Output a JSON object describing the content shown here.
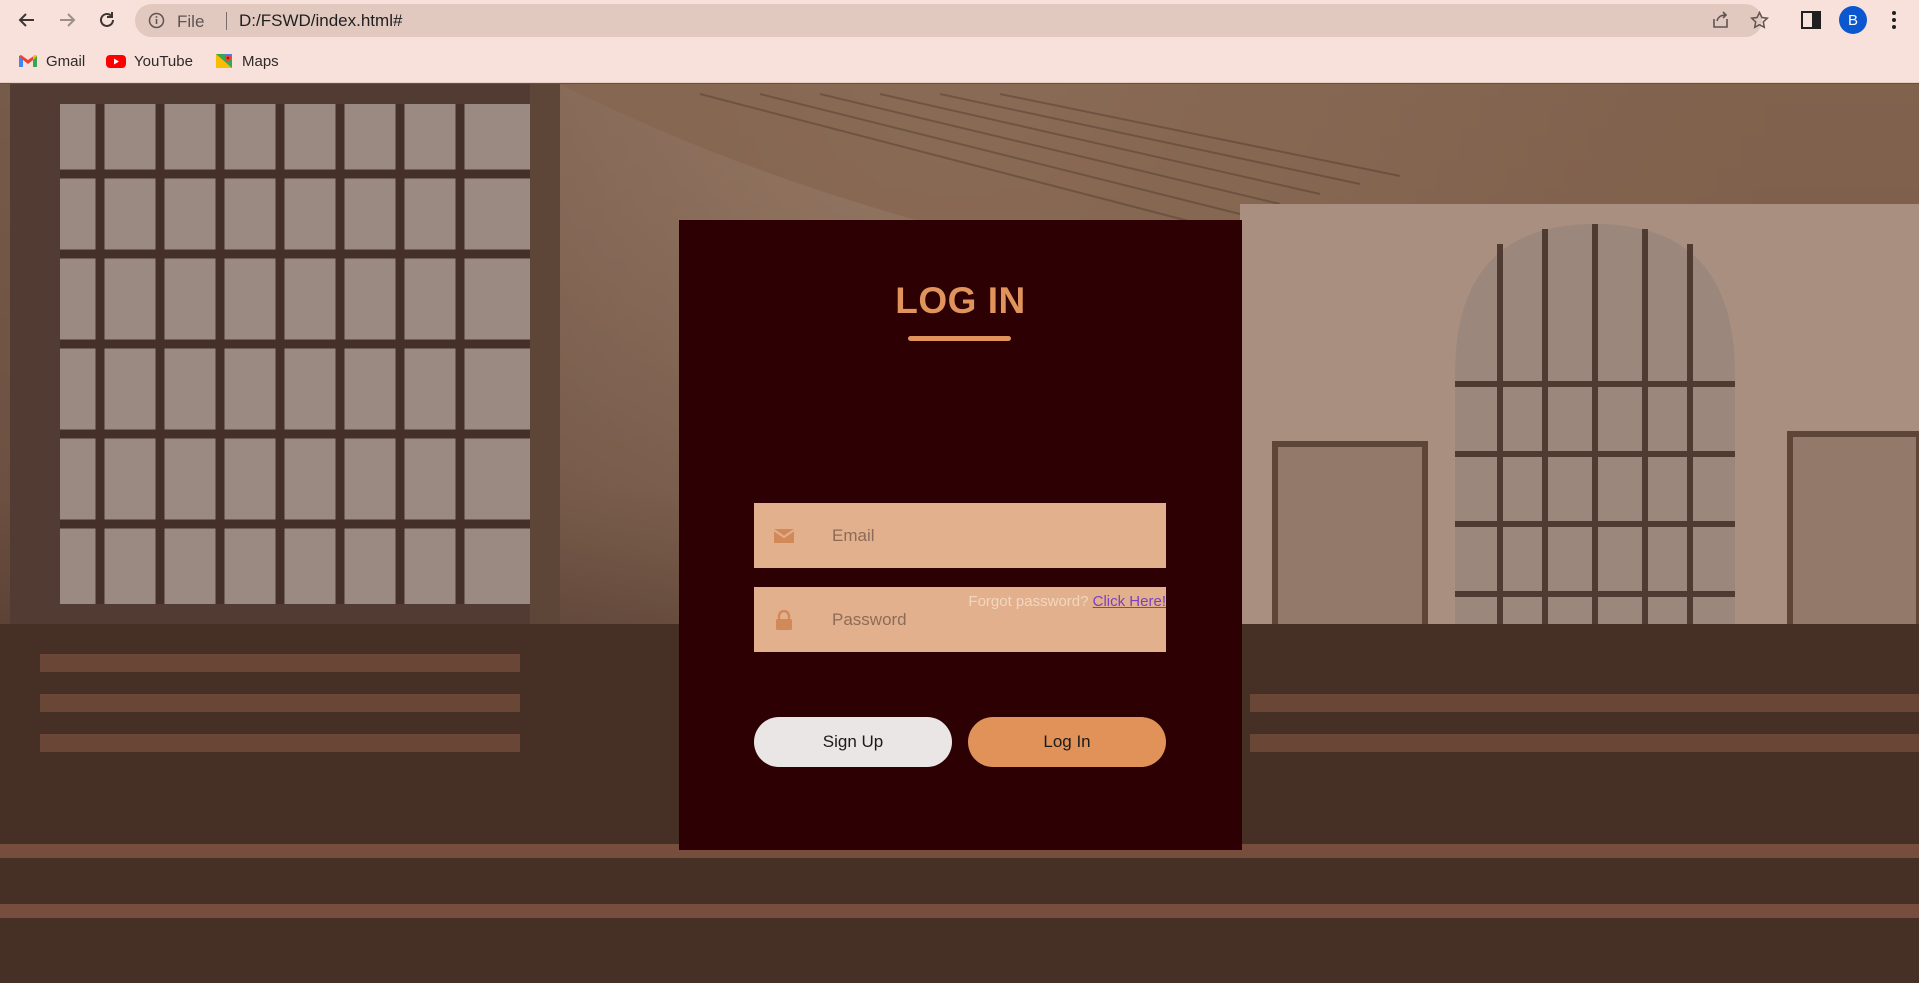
{
  "browser": {
    "url_scheme": "File",
    "url": "D:/FSWD/index.html#",
    "profile_initial": "B",
    "bookmarks": [
      {
        "label": "Gmail",
        "icon": "gmail-icon"
      },
      {
        "label": "YouTube",
        "icon": "youtube-icon"
      },
      {
        "label": "Maps",
        "icon": "maps-icon"
      }
    ]
  },
  "login": {
    "title": "LOG IN",
    "email_placeholder": "Email",
    "password_placeholder": "Password",
    "forgot_text": "Forgot password?",
    "forgot_link": "Click Here!",
    "signup_label": "Sign Up",
    "login_label": "Log In"
  },
  "colors": {
    "card": "#2d0103",
    "accent": "#e1935c",
    "field": "#e3b08d",
    "link": "#7b3fbf"
  }
}
